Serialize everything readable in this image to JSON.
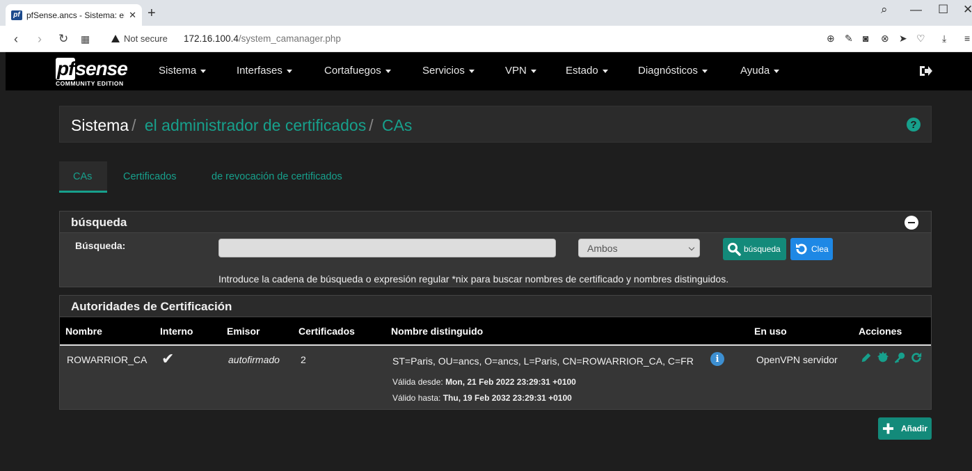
{
  "browser": {
    "tab_title": "pfSense.ancs - Sistema: el a",
    "favicon_text": "pf",
    "security_label": "Not secure",
    "url_host": "172.16.100.4",
    "url_path": "/system_camanager.php"
  },
  "nav": {
    "logo_text": "sense",
    "logo_pf": "pf",
    "logo_sub": "COMMUNITY EDITION",
    "items": [
      "Sistema",
      "Interfases",
      "Cortafuegos",
      "Servicios",
      "VPN",
      "Estado",
      "Diagnósticos",
      "Ayuda"
    ]
  },
  "breadcrumb": {
    "root": "Sistema",
    "sep": "/",
    "level1": "el administrador de certificados",
    "level2": "CAs",
    "help": "?"
  },
  "tabs": [
    "CAs",
    "Certificados",
    "de revocación de certificados"
  ],
  "search": {
    "title": "búsqueda",
    "label": "Búsqueda:",
    "input_value": "",
    "select_value": "Ambos",
    "search_button": "búsqueda",
    "clear_button": "Clea",
    "hint": "Introduce la cadena de búsqueda o expresión regular *nix para buscar nombres de certificado y nombres distinguidos."
  },
  "cas": {
    "title": "Autoridades de Certificación",
    "columns": [
      "Nombre",
      "Interno",
      "Emisor",
      "Certificados",
      "Nombre distinguido",
      "En uso",
      "Acciones"
    ],
    "rows": [
      {
        "name": "ROWARRIOR_CA",
        "internal": "✔",
        "issuer": "autofirmado",
        "certs": "2",
        "dn": "ST=Paris, OU=ancs, O=ancs, L=Paris, CN=ROWARRIOR_CA, C=FR",
        "valid_from_label": "Válida desde: ",
        "valid_from": "Mon, 21 Feb 2022 23:29:31 +0100",
        "valid_to_label": "Válido hasta: ",
        "valid_to": "Thu, 19 Feb 2032 23:29:31 +0100",
        "in_use": "OpenVPN servidor",
        "info": "i"
      }
    ]
  },
  "add_button": "Añadir",
  "colors": {
    "accent": "#17a08c",
    "button_green": "#138a7a",
    "button_blue": "#1e88e5",
    "info_blue": "#3d8fd1",
    "page_bg": "#1e1e1e"
  }
}
